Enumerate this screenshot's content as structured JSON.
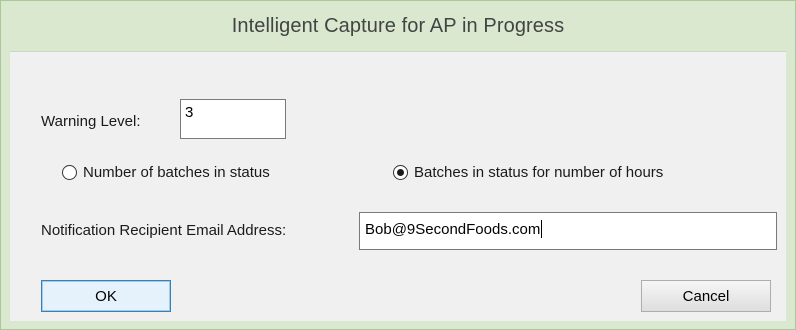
{
  "window": {
    "title": "Intelligent Capture for AP in Progress"
  },
  "form": {
    "warning_level_label": "Warning Level:",
    "warning_level_value": "3",
    "radio_option_1": "Number of batches in status",
    "radio_option_2": "Batches in status for number of hours",
    "selected_option": "Batches in status for number of hours",
    "email_label": "Notification Recipient Email Address:",
    "email_value": "Bob@9SecondFoods.com"
  },
  "buttons": {
    "ok_label": "OK",
    "cancel_label": "Cancel"
  },
  "colors": {
    "frame": "#d9e8cf",
    "client": "#f0f0f0",
    "default_button_border": "#3c7fb1"
  }
}
